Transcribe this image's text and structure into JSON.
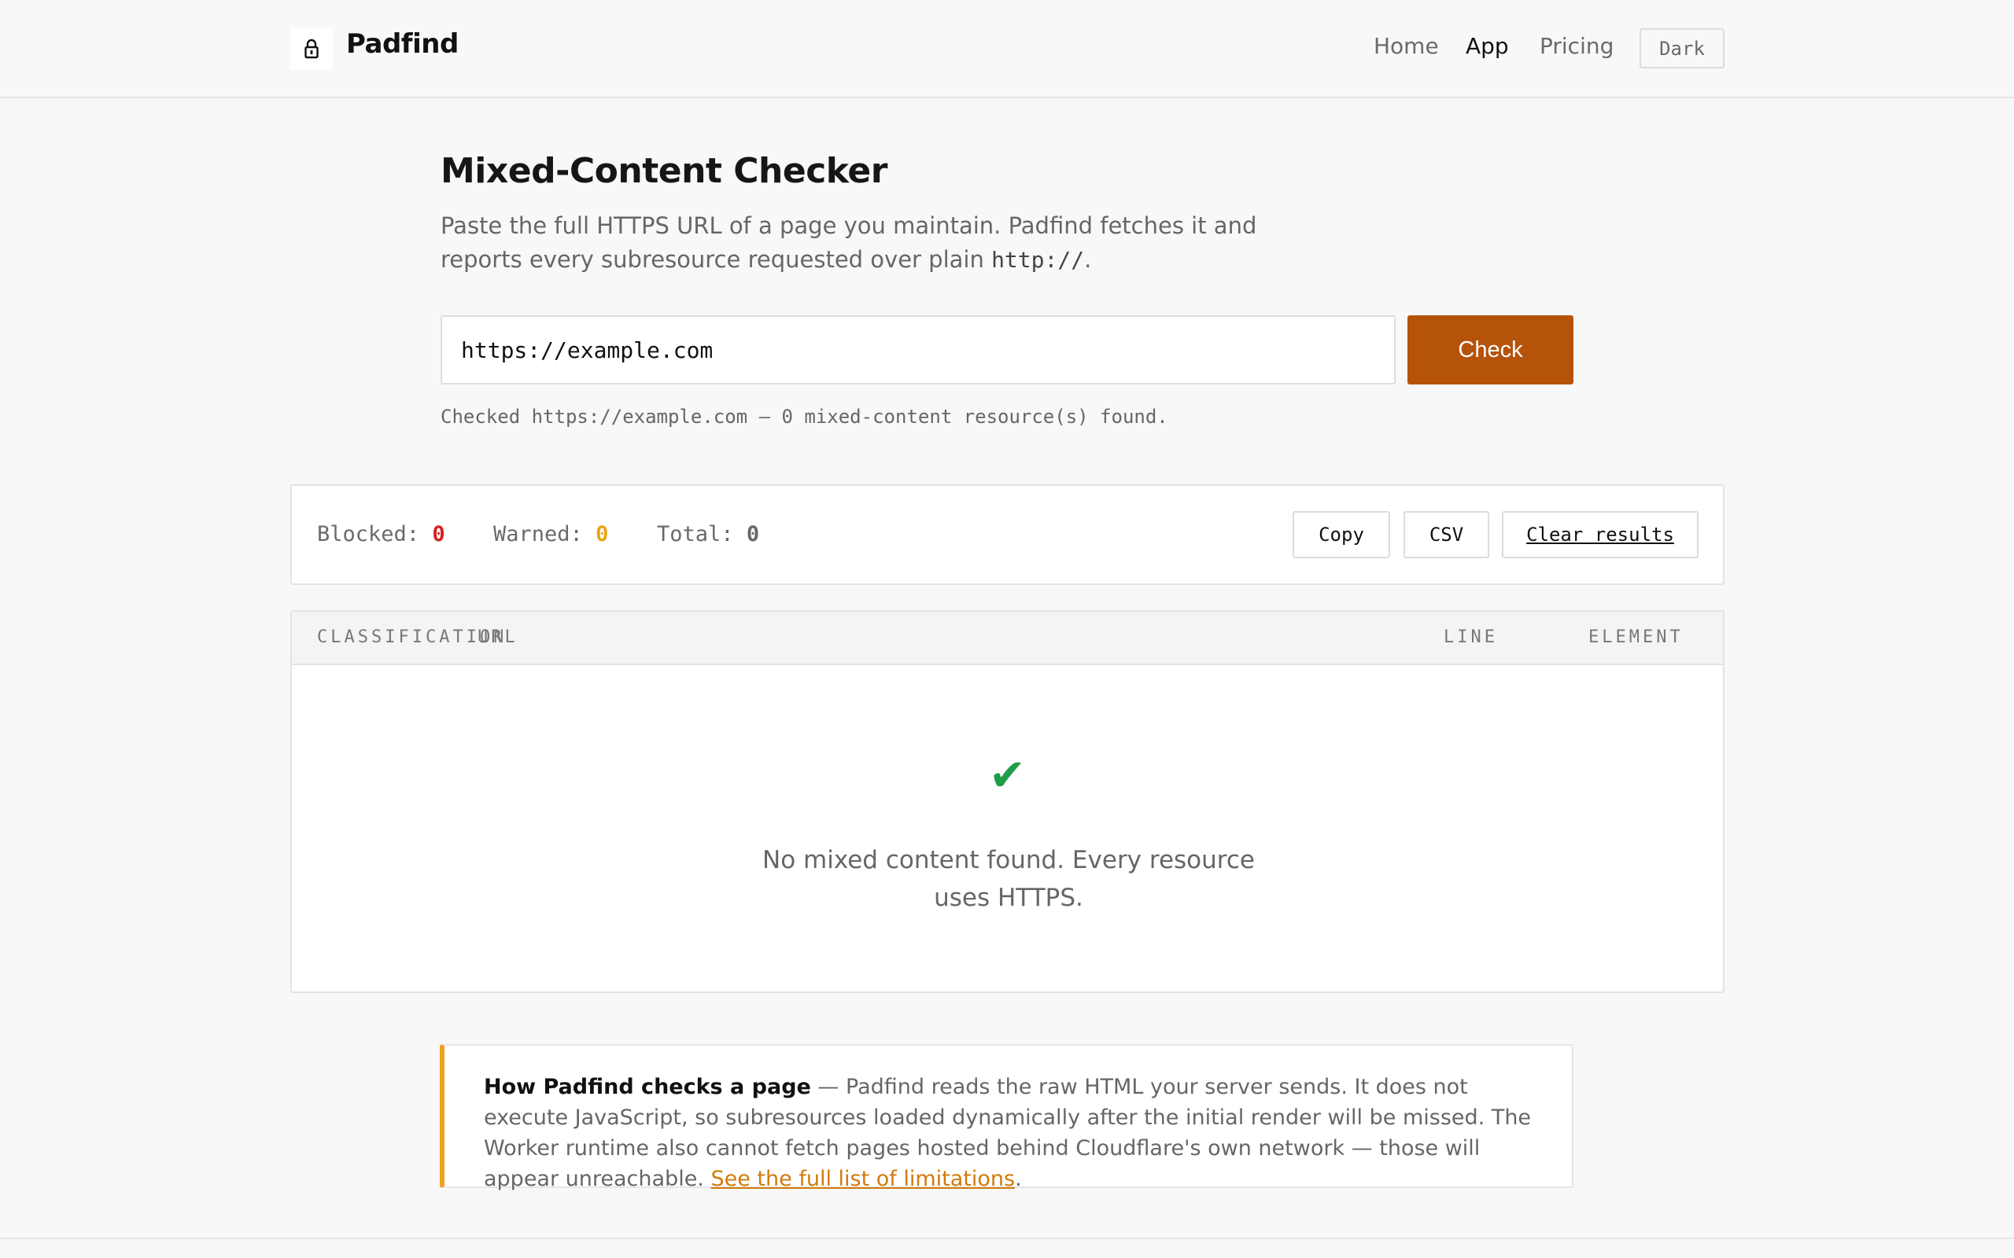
{
  "header": {
    "brand": "Padfind",
    "logo_icon": "lock-icon",
    "nav": [
      {
        "label": "Home",
        "active": false
      },
      {
        "label": "App",
        "active": true
      },
      {
        "label": "Pricing",
        "active": false
      }
    ],
    "theme_toggle": "Dark"
  },
  "main": {
    "title": "Mixed-Content Checker",
    "description_before": "Paste the full HTTPS URL of a page you maintain. Padfind fetches it and reports every subresource requested over plain ",
    "description_code": "http://",
    "description_after": ".",
    "url_input_value": "https://example.com",
    "check_label": "Check",
    "status_text": "Checked https://example.com — 0 mixed-content resource(s) found."
  },
  "summary": {
    "blocked_label": "Blocked:",
    "blocked_value": "0",
    "warned_label": "Warned:",
    "warned_value": "0",
    "total_label": "Total:",
    "total_value": "0",
    "copy_label": "Copy",
    "csv_label": "CSV",
    "clear_label": "Clear results",
    "colors": {
      "blocked": "#d42020",
      "warned": "#e8a317",
      "total": "#666666"
    }
  },
  "table": {
    "columns": [
      "CLASSIFICATION",
      "URL",
      "LINE",
      "ELEMENT"
    ],
    "empty_icon": "check-icon",
    "empty_glyph": "✔",
    "empty_message": "No mixed content found. Every resource uses HTTPS."
  },
  "note": {
    "heading": "How Padfind checks a page",
    "body": " — Padfind reads the raw HTML your server sends. It does not execute JavaScript, so subresources loaded dynamically after the initial render will be missed. The Worker runtime also cannot fetch pages hosted behind Cloudflare's own network — those will appear unreachable. ",
    "link_text": "See the full list of limitations",
    "end": "."
  },
  "colors": {
    "accent": "#b5530b",
    "success": "#1f9d48",
    "note_border": "#f0a01c",
    "link": "#d27a0c"
  }
}
